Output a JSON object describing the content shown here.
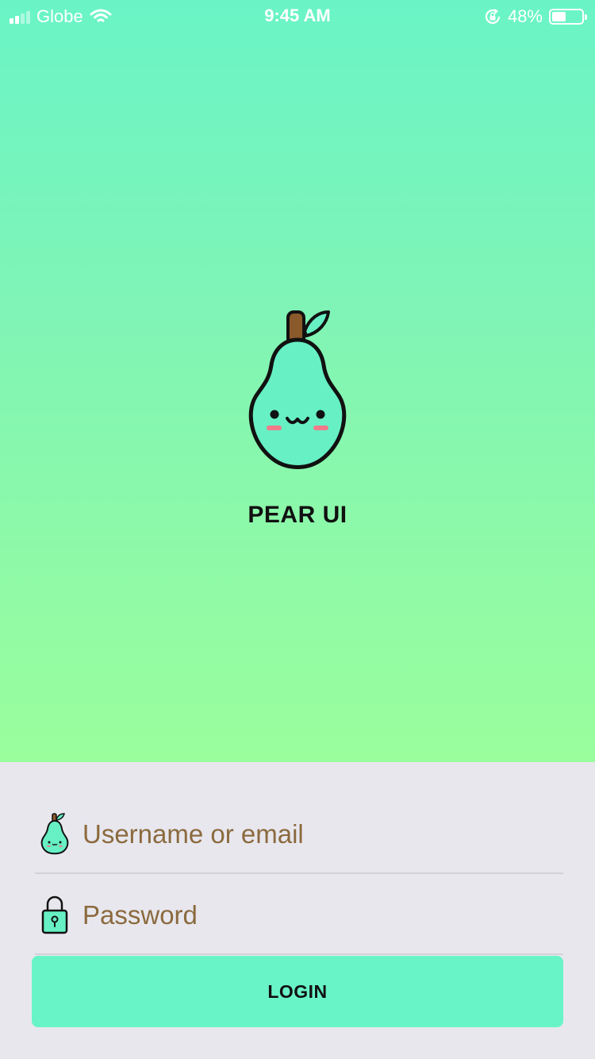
{
  "status_bar": {
    "carrier": "Globe",
    "time": "9:45 AM",
    "battery_percent": "48%",
    "battery_level": 0.48,
    "icons": [
      "signal-icon",
      "wifi-icon",
      "rotation-lock-icon",
      "battery-icon"
    ]
  },
  "app": {
    "title": "PEAR UI",
    "logo_icon": "pear-icon"
  },
  "login_form": {
    "username": {
      "placeholder": "Username or email",
      "value": "",
      "icon": "pear-icon"
    },
    "password": {
      "placeholder": "Password",
      "value": "",
      "icon": "lock-icon"
    },
    "login_label": "LOGIN"
  },
  "colors": {
    "gradient_top": "#6af4c6",
    "gradient_bottom": "#9afe9c",
    "form_background": "#e8e7ee",
    "button": "#69f4c7",
    "placeholder_text": "#8b6a3e",
    "pear_body": "#66f0c4"
  }
}
